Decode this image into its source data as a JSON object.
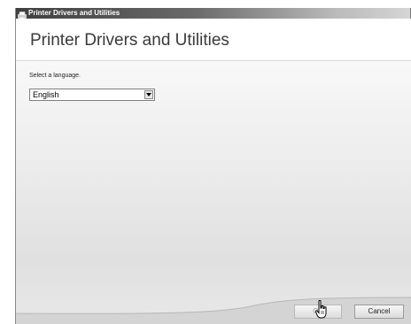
{
  "window": {
    "title": "Printer Drivers and Utilities",
    "icon": "printer-app-icon"
  },
  "header": {
    "title": "Printer Drivers and Utilities"
  },
  "language": {
    "prompt": "Select a language.",
    "selected": "English"
  },
  "buttons": {
    "ok_label": "OK",
    "cancel_label": "Cancel"
  },
  "cursor": {
    "icon": "hand-pointer-icon"
  },
  "colors": {
    "titlebar": "#3f3f3f",
    "header_text": "#3a3a3a",
    "content_bg": "#ececec"
  }
}
